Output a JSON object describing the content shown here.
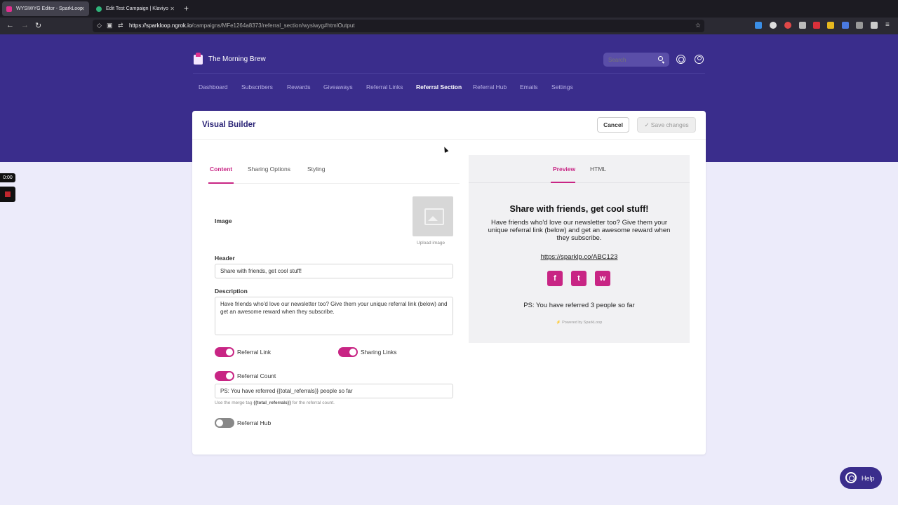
{
  "browser": {
    "tabs": [
      {
        "title": "WYSIWYG Editor - SparkLoop"
      },
      {
        "title": "Edit Test Campaign | Klaviyo"
      }
    ],
    "url_host": "https://sparkloop.ngrok.io",
    "url_path": "/campaigns/MFe1264a8373/referral_section/wysiwyg#htmlOutput"
  },
  "header": {
    "brand": "The Morning Brew",
    "search_placeholder": "Search",
    "nav": [
      "Dashboard",
      "Subscribers",
      "Rewards",
      "Giveaways",
      "Referral Links",
      "Referral Section",
      "Referral Hub",
      "Emails",
      "Settings"
    ],
    "active_nav": "Referral Section"
  },
  "card": {
    "title": "Visual Builder",
    "cancel_label": "Cancel",
    "save_label": "✓ Save changes"
  },
  "editor": {
    "tabs": [
      "Content",
      "Sharing Options",
      "Styling"
    ],
    "image_label": "Image",
    "upload_label": "Upload image",
    "header_label": "Header",
    "header_value": "Share with friends, get cool stuff!",
    "description_label": "Description",
    "description_value": "Have friends who'd love our newsletter too? Give them your unique referral link (below) and get an awesome reward when they subscribe.",
    "toggles": {
      "referral_link": {
        "label": "Referral Link",
        "on": true
      },
      "sharing_links": {
        "label": "Sharing Links",
        "on": true
      },
      "referral_count": {
        "label": "Referral Count",
        "on": true
      },
      "referral_hub": {
        "label": "Referral Hub",
        "on": false
      }
    },
    "count_value": "PS: You have referred {{total_referrals}} people so far",
    "hint_prefix": "Use the merge tag",
    "hint_tag": "{{total_referrals}}",
    "hint_suffix": "for the referral count."
  },
  "preview": {
    "tabs": [
      "Preview",
      "HTML"
    ],
    "title": "Share with friends, get cool stuff!",
    "description": "Have friends who'd love our newsletter too? Give them your unique referral link (below) and get an awesome reward when they subscribe.",
    "link": "https://sparklp.co/ABC123",
    "social": [
      "f",
      "t",
      "w"
    ],
    "count_text": "PS: You have referred 3 people so far",
    "powered": "⚡ Powered by SparkLoop"
  },
  "overlay": {
    "rec_time": "0:00",
    "help_label": "Help"
  },
  "colors": {
    "brand_purple": "#3a2d8c",
    "accent_pink": "#c82584"
  }
}
